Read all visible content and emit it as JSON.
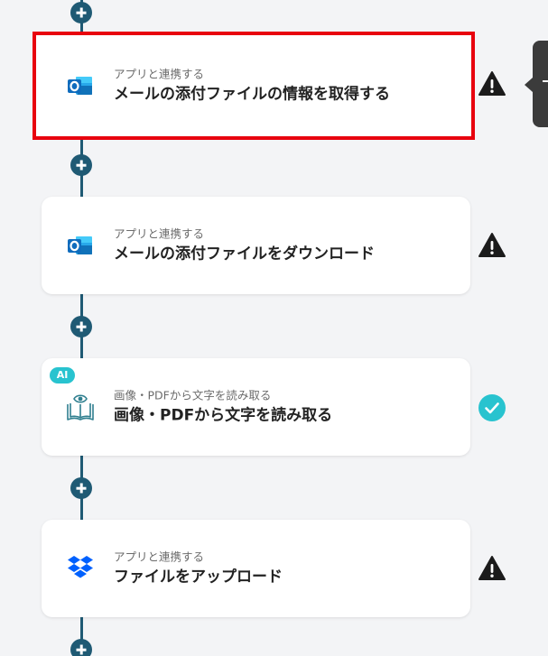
{
  "flow": {
    "steps": [
      {
        "sub_label": "アプリと連携する",
        "title": "メールの添付ファイルの情報を取得する",
        "app_icon": "outlook-icon",
        "status": "warning",
        "selected": true
      },
      {
        "sub_label": "アプリと連携する",
        "title": "メールの添付ファイルをダウンロード",
        "app_icon": "outlook-icon",
        "status": "warning",
        "selected": false
      },
      {
        "sub_label": "画像・PDFから文字を読み取る",
        "title": "画像・PDFから文字を読み取る",
        "app_icon": "book-eye-icon",
        "badge": "AI",
        "status": "completed",
        "selected": false
      },
      {
        "sub_label": "アプリと連携する",
        "title": "ファイルをアップロード",
        "app_icon": "dropbox-icon",
        "status": "warning",
        "selected": false
      }
    ]
  },
  "colors": {
    "connector": "#1f5a74",
    "selection_border": "#e8020e",
    "warning": "#1b1b1b",
    "completed": "#28c3cf",
    "ai_badge": "#28c3cf",
    "dropbox": "#0061fe"
  }
}
